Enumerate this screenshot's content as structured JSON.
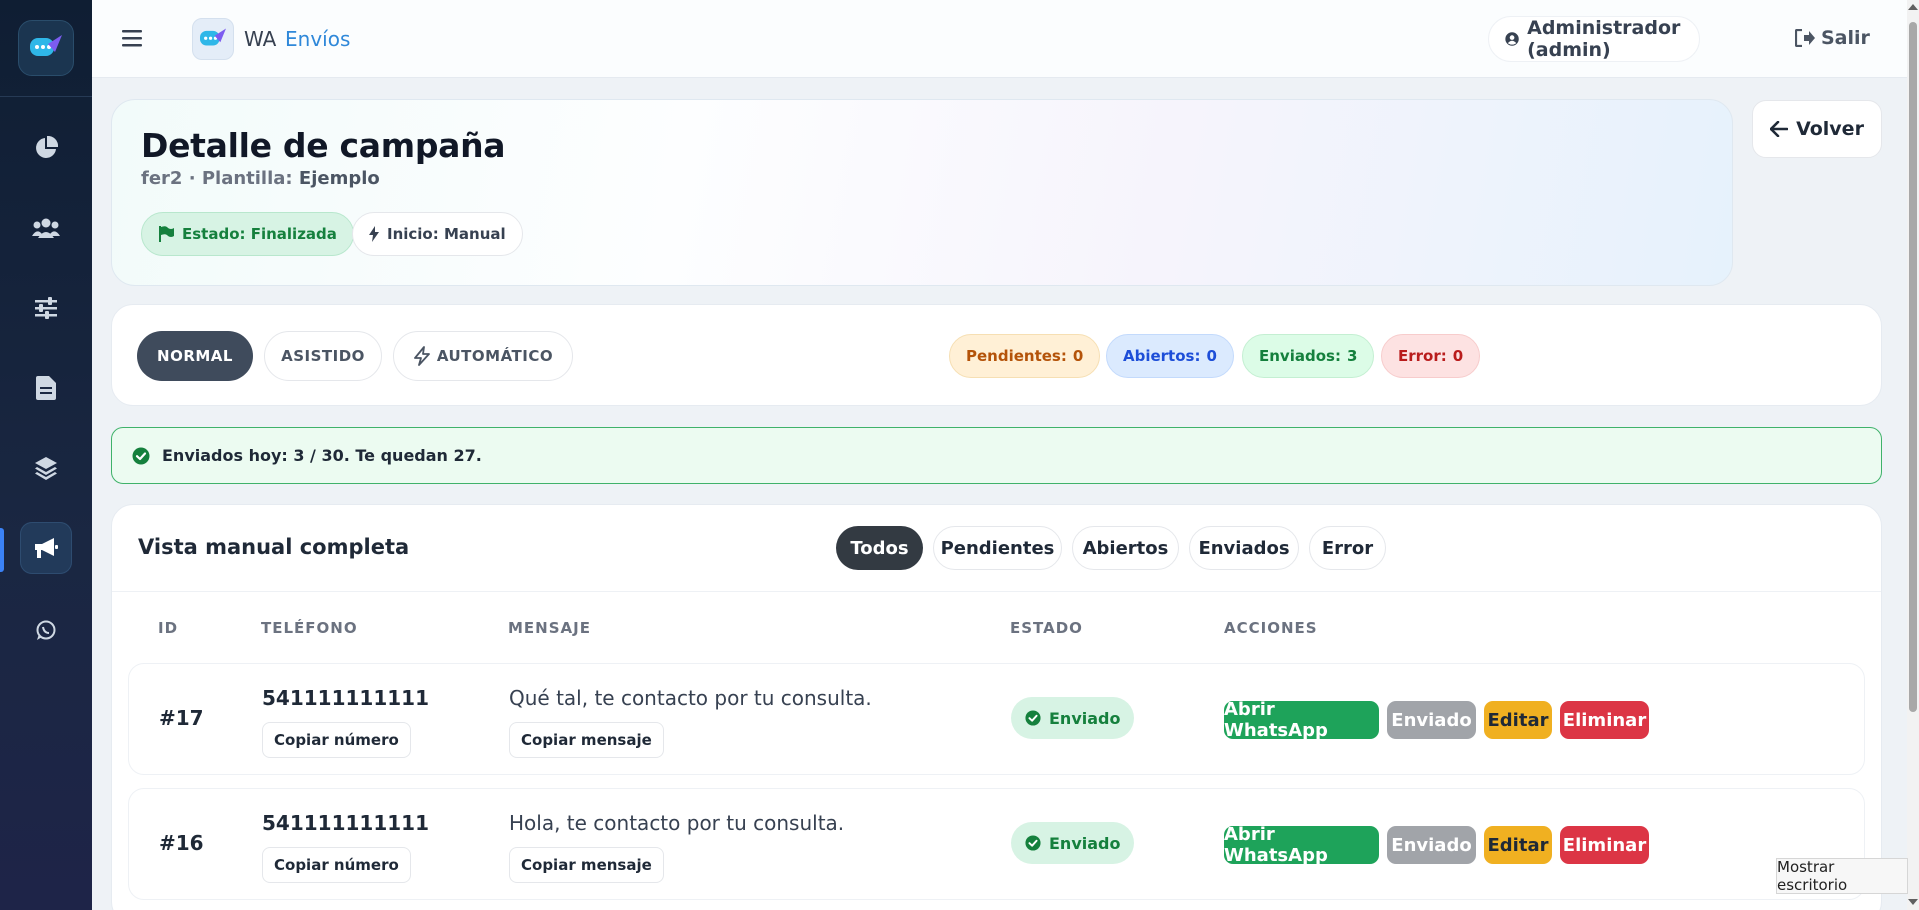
{
  "topbar": {
    "brand_wa": "WA",
    "brand_envios": "Envíos",
    "user_label": "Administrador (admin)",
    "logout_label": "Salir"
  },
  "sidebar": {
    "items": [
      {
        "icon": "pie-chart-icon"
      },
      {
        "icon": "users-icon"
      },
      {
        "icon": "sliders-icon"
      },
      {
        "icon": "document-icon"
      },
      {
        "icon": "layers-icon"
      },
      {
        "icon": "megaphone-icon",
        "active": true
      },
      {
        "icon": "whatsapp-icon"
      }
    ]
  },
  "hero": {
    "title": "Detalle de campaña",
    "campaign": "fer2",
    "template_label": "· Plantilla:",
    "template_name": "Ejemplo",
    "status_chip": "Estado: Finalizada",
    "start_chip": "Inicio: Manual",
    "back_label": "Volver"
  },
  "modes": {
    "normal": "NORMAL",
    "asistido": "ASISTIDO",
    "automatico": "AUTOMÁTICO"
  },
  "stats": {
    "pendientes_label": "Pendientes:",
    "pendientes_value": "0",
    "abiertos_label": "Abiertos:",
    "abiertos_value": "0",
    "enviados_label": "Enviados:",
    "enviados_value": "3",
    "error_label": "Error:",
    "error_value": "0"
  },
  "alert": {
    "text": "Enviados hoy: 3 / 30. Te quedan 27."
  },
  "table": {
    "title": "Vista manual completa",
    "filters": [
      "Todos",
      "Pendientes",
      "Abiertos",
      "Enviados",
      "Error"
    ],
    "headers": {
      "id": "ID",
      "phone": "TELÉFONO",
      "message": "MENSAJE",
      "status": "ESTADO",
      "actions": "ACCIONES"
    },
    "rows": [
      {
        "id": "#17",
        "phone": "541111111111",
        "copy_phone": "Copiar número",
        "message": "Qué tal, te contacto por tu consulta.",
        "copy_message": "Copiar mensaje",
        "status": "Enviado",
        "btn_whatsapp": "Abrir WhatsApp",
        "btn_sent": "Enviado",
        "btn_edit": "Editar",
        "btn_delete": "Eliminar"
      },
      {
        "id": "#16",
        "phone": "541111111111",
        "copy_phone": "Copiar número",
        "message": "Hola, te contacto por tu consulta.",
        "copy_message": "Copiar mensaje",
        "status": "Enviado",
        "btn_whatsapp": "Abrir WhatsApp",
        "btn_sent": "Enviado",
        "btn_edit": "Editar",
        "btn_delete": "Eliminar"
      }
    ]
  },
  "tooltip": {
    "text": "Mostrar escritorio"
  },
  "colors": {
    "accent": "#2f88d9",
    "success": "#15803d",
    "whatsapp": "#1ea35a",
    "danger": "#dc3545",
    "warning": "#f0b021"
  }
}
